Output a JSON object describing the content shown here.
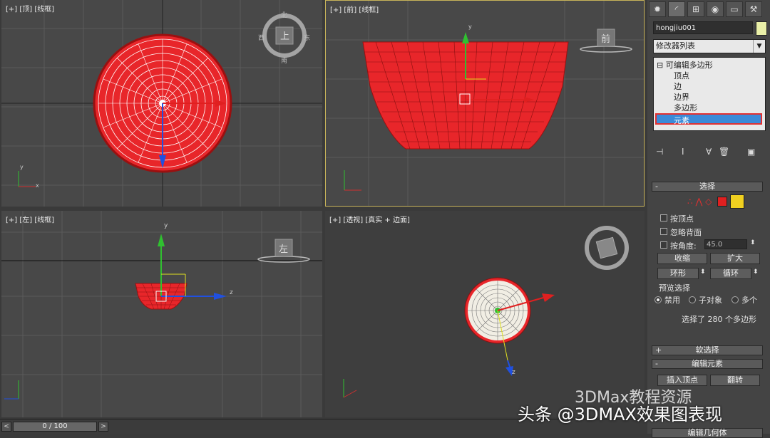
{
  "viewports": {
    "top": {
      "label": "[+] [顶] [线框]",
      "cube_label": "上",
      "compass": {
        "n": "北",
        "s": "南",
        "e": "东",
        "w": "西"
      }
    },
    "front": {
      "label": "[+] [前] [线框]",
      "cube_label": "前"
    },
    "left": {
      "label": "[+] [左] [线框]",
      "cube_label": "左"
    },
    "persp": {
      "label": "[+] [透视] [真实 + 边面]"
    }
  },
  "axes": {
    "x": "x",
    "y": "y",
    "z": "z"
  },
  "tabs": [
    {
      "icon": "sun-icon",
      "glyph": "✹"
    },
    {
      "icon": "modify-icon",
      "glyph": "◜"
    },
    {
      "icon": "hierarchy-icon",
      "glyph": "⊞"
    },
    {
      "icon": "motion-icon",
      "glyph": "◉"
    },
    {
      "icon": "display-icon",
      "glyph": "▭"
    },
    {
      "icon": "utilities-icon",
      "glyph": "⚒"
    }
  ],
  "object_name": "hongjiu001",
  "modifier_list": "修改器列表",
  "stack": {
    "root": "可编辑多边形",
    "items": [
      "顶点",
      "边",
      "边界",
      "多边形"
    ],
    "selected": "元素"
  },
  "selection": {
    "title": "选择",
    "by_vertex": "按顶点",
    "ignore_backface": "忽略背面",
    "by_angle": "按角度:",
    "angle_value": "45.0",
    "shrink": "收缩",
    "grow": "扩大",
    "ring": "环形",
    "loop": "循环",
    "preview_title": "预览选择",
    "preview_disabled": "禁用",
    "preview_subobj": "子对象",
    "preview_multi": "多个",
    "status": "选择了 280 个多边形"
  },
  "soft_selection": "软选择",
  "edit_elements": {
    "title": "编辑元素",
    "insert_vertex": "插入顶点",
    "flip": "翻转"
  },
  "edit_geometry": "编辑几何体",
  "timeline": {
    "frame": "0 / 100",
    "prev": "<",
    "next": ">"
  },
  "watermark": {
    "line1": "3DMax教程资源",
    "line2": "头条 @3DMAX效果图表现"
  },
  "colors": {
    "bowl": "#e8262a",
    "selected_item": "#3a8ad8",
    "viewport_active_border": "#c8b45a"
  }
}
